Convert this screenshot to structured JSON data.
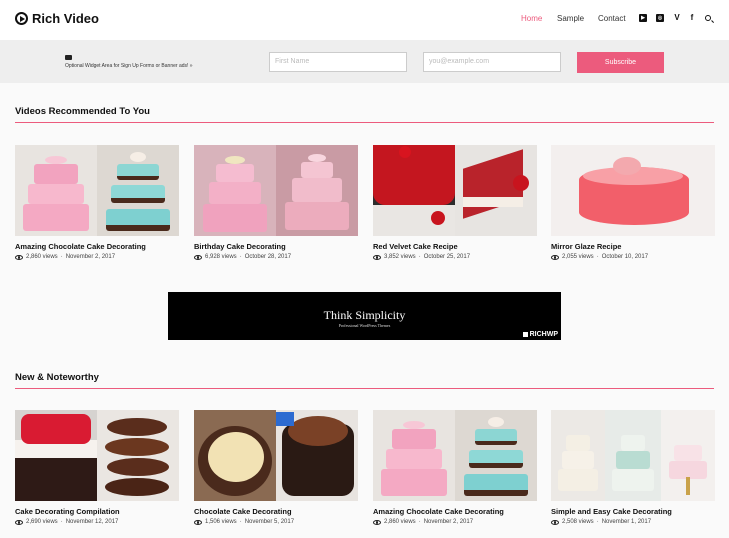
{
  "header": {
    "logo_text": "Rich Video",
    "nav": [
      {
        "label": "Home",
        "active": true
      },
      {
        "label": "Sample",
        "active": false
      },
      {
        "label": "Contact",
        "active": false
      }
    ],
    "social_icons": [
      "youtube-icon",
      "instagram-icon",
      "vimeo-icon",
      "facebook-icon",
      "search-icon"
    ]
  },
  "signup": {
    "text": "Optional Widget Area for Sign Up Forms or Banner ads! »",
    "name_placeholder": "First Name",
    "email_placeholder": "you@example.com",
    "button_label": "Subscribe"
  },
  "sections": {
    "recommended": {
      "title": "Videos Recommended To You",
      "videos": [
        {
          "title": "Amazing Chocolate Cake Decorating",
          "views": "2,860 views",
          "date": "November 2, 2017"
        },
        {
          "title": "Birthday Cake Decorating",
          "views": "6,928 views",
          "date": "October 28, 2017"
        },
        {
          "title": "Red Velvet Cake Recipe",
          "views": "3,852 views",
          "date": "October 25, 2017"
        },
        {
          "title": "Mirror Glaze Recipe",
          "views": "2,055 views",
          "date": "October 10, 2017"
        }
      ]
    },
    "noteworthy": {
      "title": "New & Noteworthy",
      "videos": [
        {
          "title": "Cake Decorating Compilation",
          "views": "2,690 views",
          "date": "November 12, 2017"
        },
        {
          "title": "Chocolate Cake Decorating",
          "views": "1,506 views",
          "date": "November 5, 2017"
        },
        {
          "title": "Amazing Chocolate Cake Decorating",
          "views": "2,860 views",
          "date": "November 2, 2017"
        },
        {
          "title": "Simple and Easy Cake Decorating",
          "views": "2,508 views",
          "date": "November 1, 2017"
        }
      ]
    }
  },
  "banner": {
    "title": "Think Simplicity",
    "subtitle": "Professional WordPress Themes",
    "brand": "RICHWP"
  },
  "colors": {
    "accent": "#ec5b7d",
    "signup_bg": "#eeeeee",
    "banner_bg": "#000000"
  }
}
